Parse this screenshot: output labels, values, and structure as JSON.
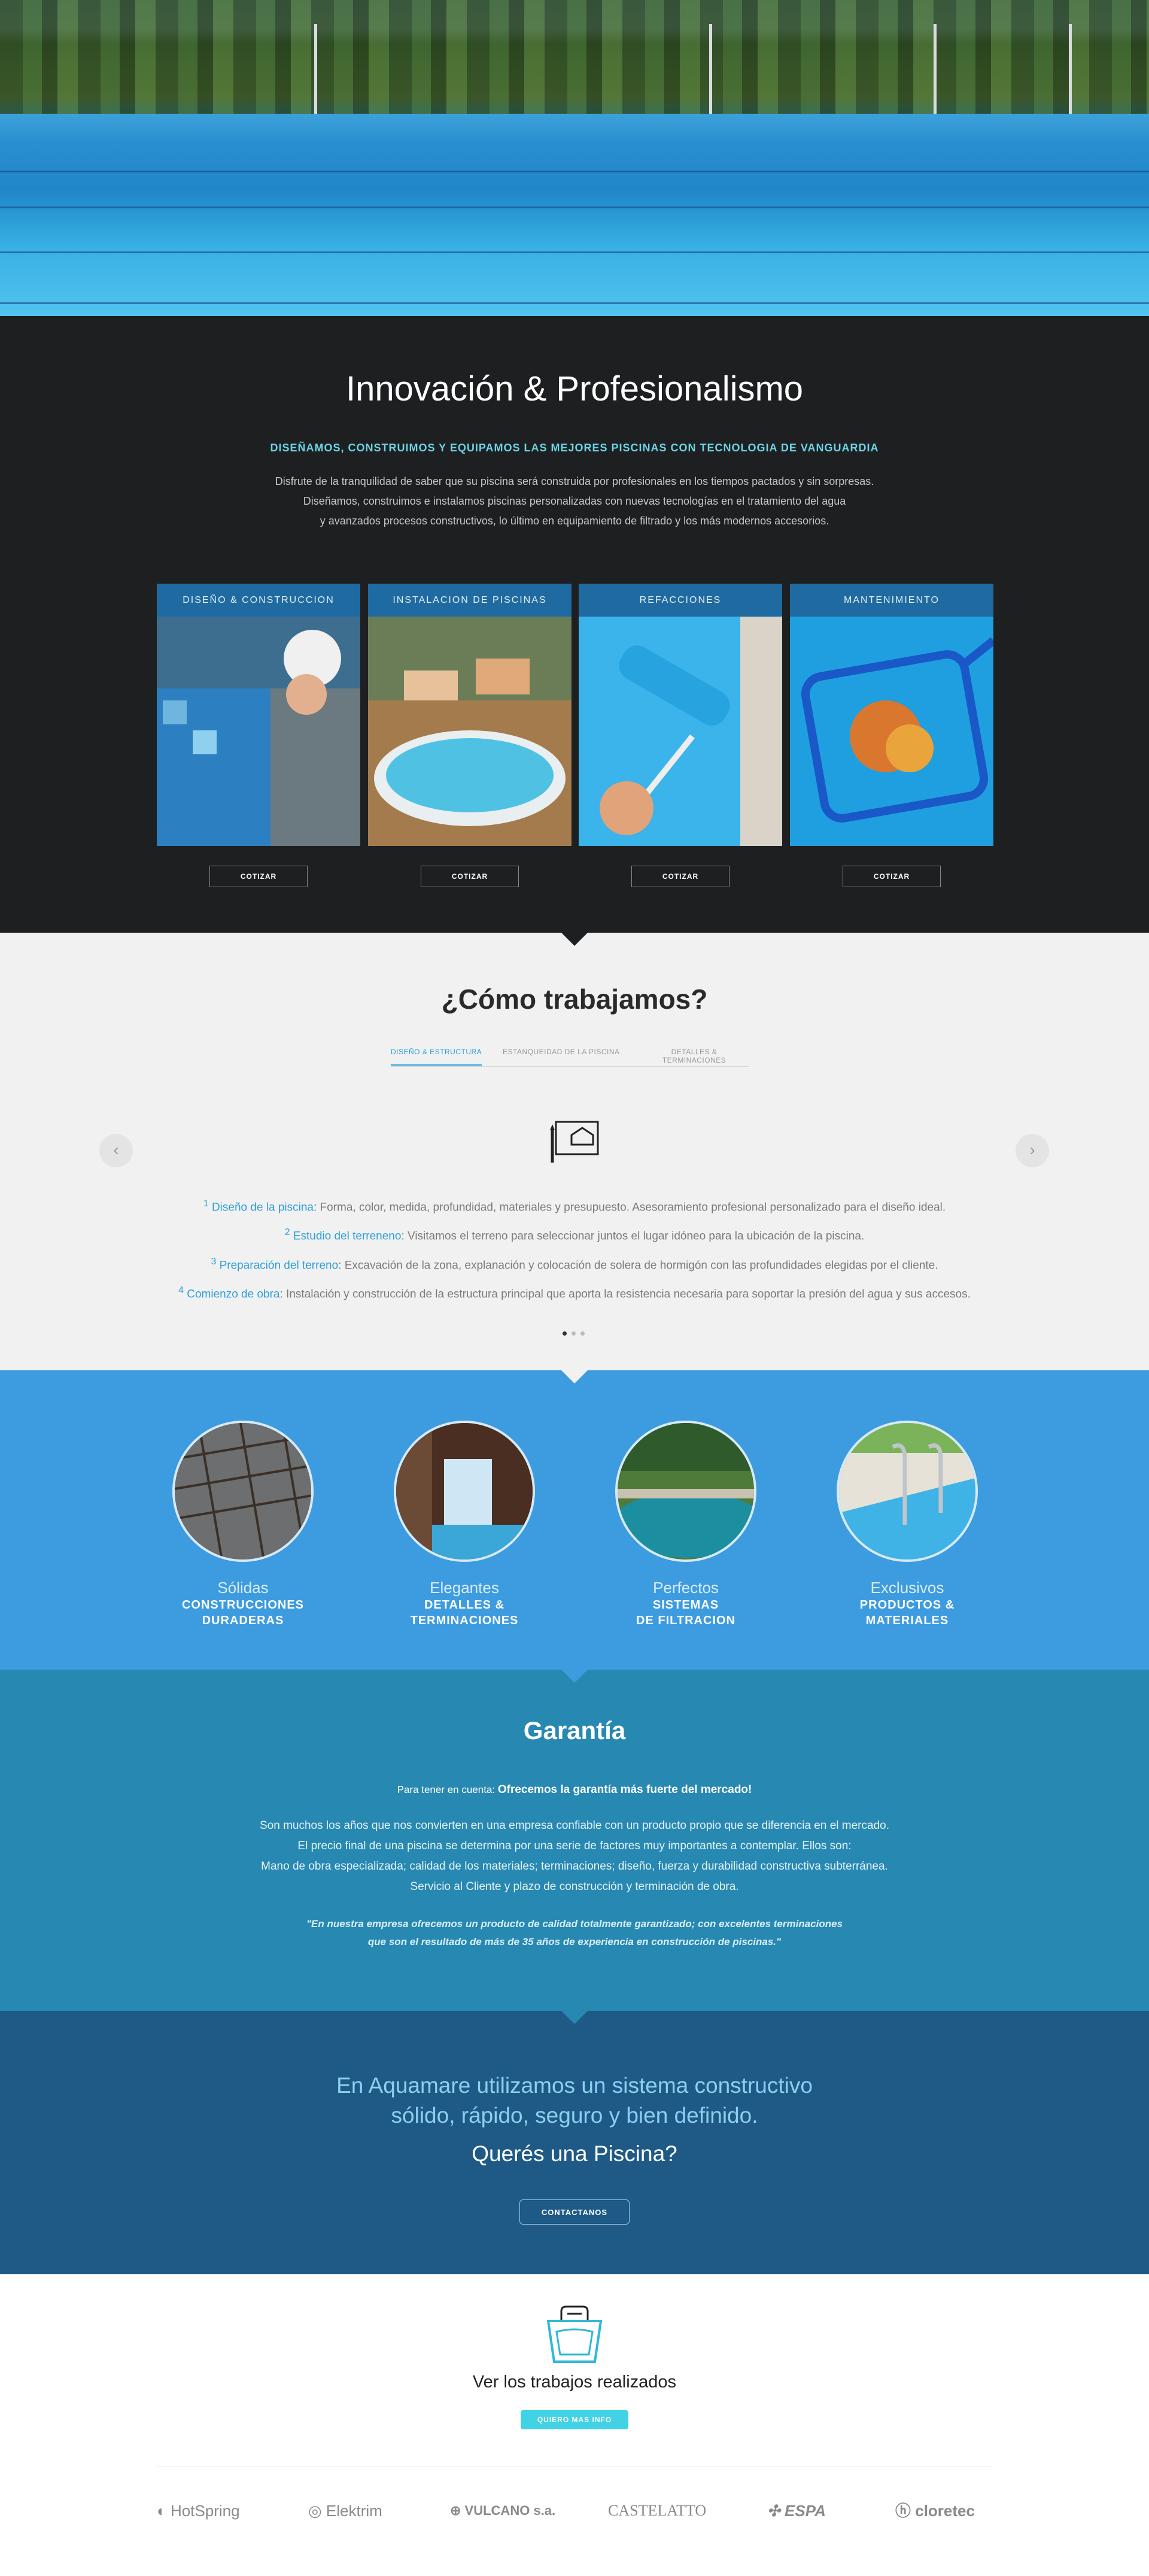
{
  "innovacion": {
    "title": "Innovación & Profesionalismo",
    "subtitle": "DISEÑAMOS, CONSTRUIMOS Y EQUIPAMOS LAS MEJORES PISCINAS CON TECNOLOGIA DE VANGUARDIA",
    "desc_1": "Disfrute de la tranquilidad de saber que su piscina será construida por profesionales en los tiempos pactados y sin sorpresas.",
    "desc_2": "Diseñamos, construimos e instalamos piscinas personalizadas con nuevas tecnologías en el tratamiento del agua",
    "desc_3": "y avanzados procesos constructivos, lo último en equipamiento de filtrado y los más modernos accesorios.",
    "cards": [
      {
        "label": "DISEÑO & CONSTRUCCION",
        "button": "COTIZAR"
      },
      {
        "label": "INSTALACION DE PISCINAS",
        "button": "COTIZAR"
      },
      {
        "label": "REFACCIONES",
        "button": "COTIZAR"
      },
      {
        "label": "MANTENIMIENTO",
        "button": "COTIZAR"
      }
    ]
  },
  "como": {
    "title": "¿Cómo trabajamos?",
    "tabs": [
      "DISEÑO & ESTRUCTURA",
      "ESTANQUEIDAD DE LA PISCINA",
      "DETALLES & TERMINACIONES"
    ],
    "steps": [
      {
        "num": "1",
        "key": "Diseño de la piscina",
        "text": ": Forma, color, medida, profundidad, materiales y presupuesto. Asesoramiento profesional personalizado para el diseño ideal."
      },
      {
        "num": "2",
        "key": "Estudio del terreneno",
        "text": ": Visitamos el terreno para seleccionar juntos el lugar idóneo para la ubicación de la piscina."
      },
      {
        "num": "3",
        "key": "Preparación del terreno",
        "text": ": Excavación de la zona, explanación y colocación de solera de hormigón con las profundidades elegidas por el cliente."
      },
      {
        "num": "4",
        "key": "Comienzo de obra",
        "text": ": Instalación y construcción de la estructura principal que aporta la resistencia necesaria para soportar la presión del agua y sus accesos."
      }
    ]
  },
  "features": [
    {
      "l1": "Sólidas",
      "l2a": "CONSTRUCCIONES",
      "l2b": "DURADERAS"
    },
    {
      "l1": "Elegantes",
      "l2a": "DETALLES &",
      "l2b": "TERMINACIONES"
    },
    {
      "l1": "Perfectos",
      "l2a": "SISTEMAS",
      "l2b": "DE FILTRACION"
    },
    {
      "l1": "Exclusivos",
      "l2a": "PRODUCTOS &",
      "l2b": "MATERIALES"
    }
  ],
  "garantia": {
    "title": "Garantía",
    "lead_small": "Para tener en cuenta: ",
    "lead_bold": "Ofrecemos la garantía más fuerte del mercado!",
    "body_1": "Son muchos los años que nos convierten en una empresa confiable con un producto propio que se diferencia en el mercado.",
    "body_2": "El precio final de una piscina se determina por una serie de factores muy importantes a contemplar. Ellos son:",
    "body_3": "Mano de obra especializada; calidad de los materiales; terminaciones; diseño, fuerza y durabilidad constructiva subterránea.",
    "body_4": "Servicio al Cliente y plazo de construcción y terminación de obra.",
    "quote_1": "\"En nuestra empresa ofrecemos un producto de calidad totalmente garantizado; con excelentes terminaciones",
    "quote_2": "que son el resultado de más de 35 años de experiencia en construcción de piscinas.\""
  },
  "cta": {
    "line1": "En Aquamare utilizamos un sistema constructivo",
    "line2": "sólido, rápido, seguro y bien definido.",
    "question": "Querés una Piscina?",
    "button": "CONTACTANOS"
  },
  "works": {
    "title": "Ver los trabajos realizados",
    "button": "QUIERO MAS INFO"
  },
  "brands": [
    "HotSpring",
    "Elektrim",
    "VULCANO s.a.",
    "CASTELATTO",
    "ESPA",
    "cloretec"
  ],
  "colors": {
    "accent": "#2d9fd9",
    "dark": "#1e1f21",
    "feature_blue": "#3d9be0",
    "garantia_blue": "#2788b2",
    "cta_blue": "#1f5a86",
    "cyan_button": "#41d2e6"
  }
}
